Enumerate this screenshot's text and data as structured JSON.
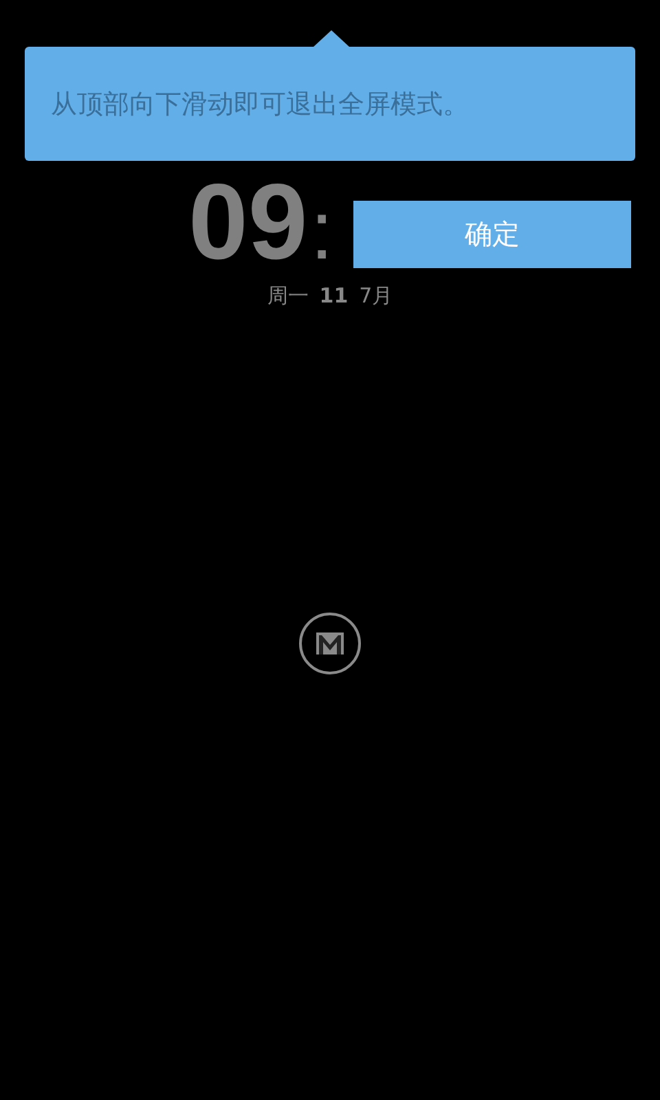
{
  "tooltip": {
    "message": "从顶部向下滑动即可退出全屏模式。",
    "button": "确定"
  },
  "clock": {
    "hours": "09",
    "separator": ":"
  },
  "date": {
    "weekday": "周一",
    "day": "11",
    "month": "7月"
  }
}
